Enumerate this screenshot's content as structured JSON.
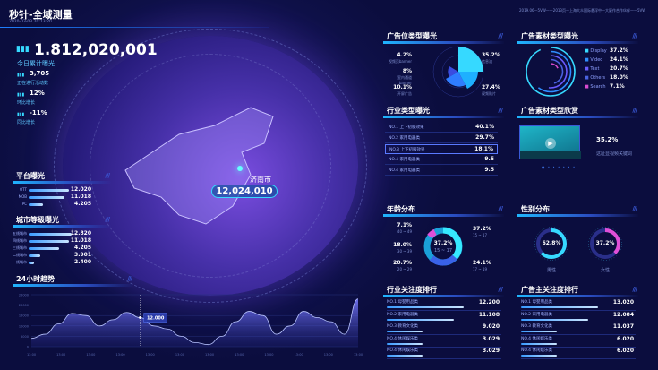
{
  "header": {
    "title": "秒针-全域测量",
    "datetime": "2020-03-03 20:13:20",
    "right_info": "2019.06—5VW——2013页—上海大众国际悬浮中—大厦作合作伙伴——5VW"
  },
  "kpi": {
    "total": "1.812,020,001",
    "total_label": "今日累计曝光",
    "items": [
      {
        "value": "3,705",
        "label": "正在进行活动数"
      },
      {
        "value": "12%",
        "label": "环比增长"
      },
      {
        "value": "-11%",
        "label": "同比增长"
      }
    ]
  },
  "platform": {
    "title": "平台曝光",
    "items": [
      {
        "label": "OTT",
        "value": "12.020",
        "pct": 0.9
      },
      {
        "label": "MOB",
        "value": "11.018",
        "pct": 0.8
      },
      {
        "label": "PC",
        "value": "4.205",
        "pct": 0.32
      }
    ]
  },
  "city": {
    "title": "城市等级曝光",
    "items": [
      {
        "label": "五线城市",
        "value": "12.820",
        "pct": 0.95
      },
      {
        "label": "四线城市",
        "value": "11.018",
        "pct": 0.9
      },
      {
        "label": "三线城市",
        "value": "4.205",
        "pct": 0.68
      },
      {
        "label": "二线城市",
        "value": "3.901",
        "pct": 0.25
      },
      {
        "label": "一线城市",
        "value": "2.400",
        "pct": 0.12
      }
    ]
  },
  "map": {
    "city": "济南市",
    "value": "12,024,010"
  },
  "ad_position": {
    "title": "广告位类型曝光",
    "items": [
      {
        "pct": "4.2%",
        "label": "视频页banner"
      },
      {
        "pct": "8%",
        "label": "室内通道banner"
      },
      {
        "pct": "10.1%",
        "label": "开屏广告"
      },
      {
        "pct": "35.2%",
        "label": "信息流"
      },
      {
        "pct": "27.4%",
        "label": "视频贴片"
      }
    ]
  },
  "ad_material": {
    "title": "广告素材类型曝光",
    "items": [
      {
        "label": "Display",
        "pct": "37.2%",
        "value": 37.2,
        "color": "#36d9ff"
      },
      {
        "label": "Video",
        "pct": "24.1%",
        "value": 24.1,
        "color": "#2f8dff"
      },
      {
        "label": "Text",
        "pct": "20.7%",
        "value": 20.7,
        "color": "#6a5cff"
      },
      {
        "label": "Others",
        "pct": "18.0%",
        "value": 18.0,
        "color": "#4a62e0"
      },
      {
        "label": "Search",
        "pct": "7.1%",
        "value": 7.1,
        "color": "#d94bd0"
      }
    ]
  },
  "industry": {
    "title": "行业类型曝光",
    "items": [
      {
        "label": "NO.1 上下初服效果",
        "value": "40.1%"
      },
      {
        "label": "NO.2 家用电器类",
        "value": "29.7%"
      },
      {
        "label": "NO.3 上下初服效果",
        "value": "18.1%"
      },
      {
        "label": "NO.4 家用电器类",
        "value": "9.5"
      },
      {
        "label": "NO.4 家用电器类",
        "value": "9.5"
      }
    ]
  },
  "material_view": {
    "title": "广告素材类型欣赏",
    "pct": "35.2%",
    "label": "这趾显视频关键词"
  },
  "age": {
    "title": "年龄分布",
    "center_pct": "37.2%",
    "center_label": "15 ~ 17",
    "items": [
      {
        "pct": "7.1%",
        "range": "40 ~ 49"
      },
      {
        "pct": "18.0%",
        "range": "30 ~ 39"
      },
      {
        "pct": "20.7%",
        "range": "20 ~ 29"
      },
      {
        "pct": "37.2%",
        "range": "15 ~ 17"
      },
      {
        "pct": "24.1%",
        "range": "17 ~ 19"
      }
    ]
  },
  "gender": {
    "title": "性别分布",
    "items": [
      {
        "pct": "62.8%",
        "label": "男性",
        "value": 62.8,
        "color": "#36d9ff"
      },
      {
        "pct": "37.2%",
        "label": "女性",
        "value": 37.2,
        "color": "#e04fd8"
      }
    ]
  },
  "industry_rank": {
    "title": "行业关注度排行",
    "items": [
      {
        "label": "NO.1 母婴用品类",
        "value": "12.200",
        "pct": 0.75
      },
      {
        "label": "NO.2 家用电器类",
        "value": "11.108",
        "pct": 0.65
      },
      {
        "label": "NO.3 教育文化类",
        "value": "9.020",
        "pct": 0.35
      },
      {
        "label": "NO.4 休闲娱乐类",
        "value": "3.029",
        "pct": 0.35
      },
      {
        "label": "NO.4 休闲娱乐类",
        "value": "3.029",
        "pct": 0.35
      }
    ]
  },
  "advertiser_rank": {
    "title": "广告主关注度排行",
    "items": [
      {
        "label": "NO.1 母婴用品类",
        "value": "13.020",
        "pct": 0.75
      },
      {
        "label": "NO.2 家用电器类",
        "value": "12.084",
        "pct": 0.65
      },
      {
        "label": "NO.3 教育文化类",
        "value": "11.037",
        "pct": 0.35
      },
      {
        "label": "NO.4 休闲娱乐类",
        "value": "6.020",
        "pct": 0.35
      },
      {
        "label": "NO.4 休闲娱乐类",
        "value": "6.020",
        "pct": 0.35
      }
    ]
  },
  "chart_data": {
    "type": "area",
    "title": "24小时趋势",
    "x": [
      "13:00",
      "13:00",
      "13:00",
      "13:00",
      "13:00",
      "13:00",
      "13:00",
      "13:00",
      "13:00",
      "13:00",
      "13:00",
      "13:00"
    ],
    "yticks": [
      "0",
      "5000",
      "10000",
      "15000",
      "20000",
      "25000"
    ],
    "ylim": [
      0,
      25000
    ],
    "values": [
      4000,
      6000,
      11000,
      16000,
      15000,
      10000,
      13000,
      16500,
      14000,
      10000,
      8500,
      5000,
      2000,
      1000,
      5000,
      12000,
      17000,
      15000,
      6000,
      10000,
      17000,
      14000,
      12000,
      6000,
      23000
    ],
    "tooltip": "12.000"
  }
}
